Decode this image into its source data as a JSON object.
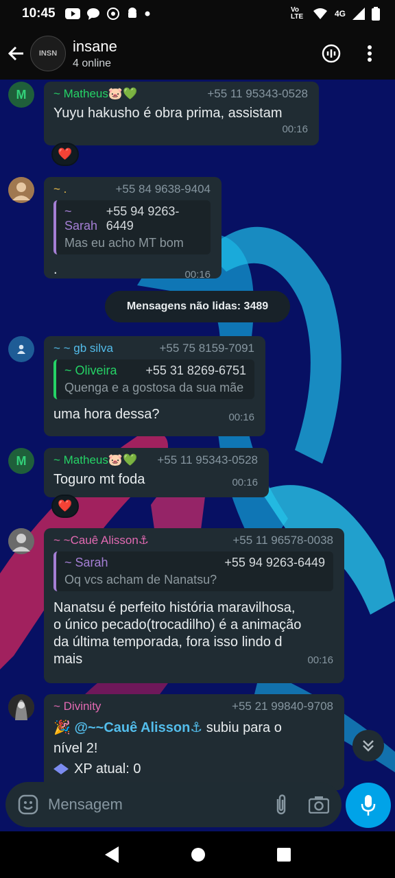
{
  "statusbar": {
    "time": "10:45",
    "network": "4G",
    "volte": "Vo LTE"
  },
  "header": {
    "title": "insane",
    "subtitle": "4 online",
    "avatar_text": "INSN"
  },
  "colors": {
    "wallpaper": "#071063",
    "bubble": "#202c33",
    "green_name": "#25d366",
    "yellow_name": "#f2c34c",
    "blue_name": "#53bdeb",
    "pink_name": "#e26ab2",
    "quote_purple": "#a57fd5",
    "quote_green": "#25d366",
    "mic": "#00a3e8"
  },
  "messages": [
    {
      "avatar_letter": "M",
      "sender": "~ Matheus🐷💚",
      "phone": "+55 11 95343-0528",
      "text": "Yuyu hakusho é obra prima,  assistam",
      "time": "00:16",
      "reaction": "❤️"
    },
    {
      "sender": "~ .",
      "phone": "+55 84 9638-9404",
      "quote": {
        "name": "~ Sarah",
        "phone": "+55 94 9263-6449",
        "text": "Mas eu acho MT bom"
      },
      "text": ".",
      "time": "00:16"
    },
    {
      "sender": "~ ~ gb silva",
      "phone": "+55 75 8159-7091",
      "quote": {
        "name": "~ Oliveira",
        "phone": "+55 31 8269-6751",
        "text": "Quenga e a gostosa da sua mãe"
      },
      "text": "uma hora dessa?",
      "time": "00:16"
    },
    {
      "avatar_letter": "M",
      "sender": "~ Matheus🐷💚",
      "phone": "+55 11 95343-0528",
      "text": "Toguro mt foda",
      "time": "00:16",
      "reaction": "❤️"
    },
    {
      "sender": "~ ~Cauê Alisson⚓",
      "phone": "+55 11 96578-0038",
      "quote": {
        "name": "~ Sarah",
        "phone": "+55 94 9263-6449",
        "text": "Oq vcs acham de Nanatsu?"
      },
      "text_lines": [
        "Nanatsu é perfeito história maravilhosa,",
        "o único pecado(trocadilho) é a animação",
        "da última temporada, fora isso lindo d",
        "mais"
      ],
      "time": "00:16"
    },
    {
      "sender": "~ Divinity",
      "phone": "+55 21 99840-9708",
      "party": "🎉",
      "mention": "@~~Cauê Alisson⚓",
      "text_after_mention": " subiu para o",
      "text_line2": "nível 2!",
      "xp_line": "XP atual: 0"
    }
  ],
  "unread_label": "Mensagens não lidas: 3489",
  "input": {
    "placeholder": "Mensagem"
  }
}
